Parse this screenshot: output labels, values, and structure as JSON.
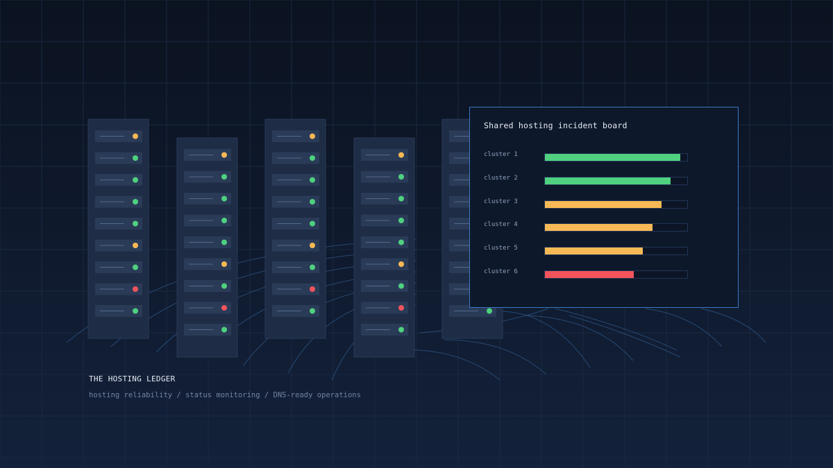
{
  "colors": {
    "background": "#0c1322",
    "grid": "#1a2840",
    "rack": "#1e2c45",
    "slot": "#2a3b58",
    "ok": "#4fd17f",
    "warn": "#f7b955",
    "down": "#f2545b",
    "link": "#2e5a8a"
  },
  "racks": [
    {
      "leds": [
        "warn",
        "ok",
        "ok",
        "ok",
        "ok",
        "warn",
        "ok",
        "down",
        "ok"
      ]
    },
    {
      "leds": [
        "warn",
        "ok",
        "ok",
        "ok",
        "ok",
        "warn",
        "ok",
        "down",
        "ok"
      ]
    },
    {
      "leds": [
        "warn",
        "ok",
        "ok",
        "ok",
        "ok",
        "warn",
        "ok",
        "down",
        "ok"
      ]
    },
    {
      "leds": [
        "warn",
        "ok",
        "ok",
        "ok",
        "ok",
        "warn",
        "ok",
        "down",
        "ok"
      ]
    },
    {
      "leds": [
        "off",
        "ok",
        "ok",
        "ok",
        "ok",
        "ok",
        "ok",
        "off",
        "ok"
      ]
    }
  ],
  "board": {
    "title": "Shared hosting incident board",
    "clusters": [
      {
        "label": "cluster 1",
        "level": 0.95,
        "status": "ok"
      },
      {
        "label": "cluster 2",
        "level": 0.885,
        "status": "ok"
      },
      {
        "label": "cluster 3",
        "level": 0.82,
        "status": "warn"
      },
      {
        "label": "cluster 4",
        "level": 0.755,
        "status": "warn"
      },
      {
        "label": "cluster 5",
        "level": 0.69,
        "status": "warn"
      },
      {
        "label": "cluster 6",
        "level": 0.625,
        "status": "down"
      }
    ]
  },
  "footer": {
    "brand": "THE HOSTING LEDGER",
    "tagline": "hosting reliability / status monitoring / DNS-ready operations"
  }
}
